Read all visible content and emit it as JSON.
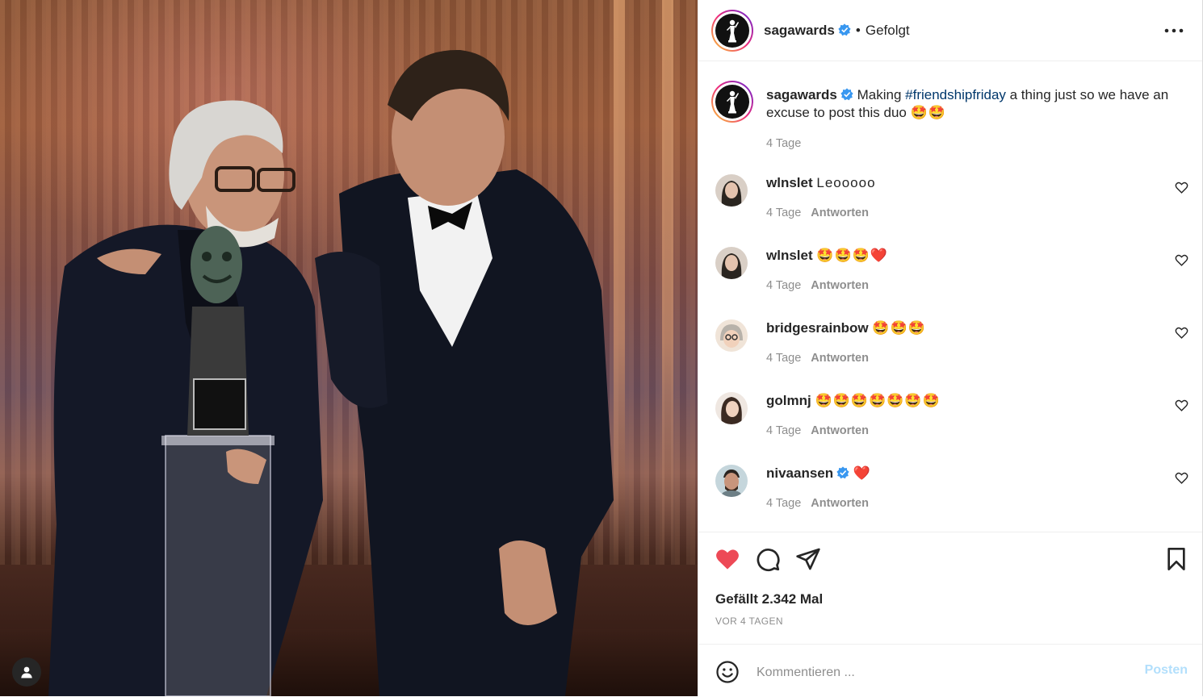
{
  "post": {
    "author": "sagawards",
    "follow_status": "Gefolgt",
    "separator": "•"
  },
  "caption": {
    "author": "sagawards",
    "text_before": "Making ",
    "hashtag": "#friendshipfriday",
    "text_after": " a thing just so we have an excuse to post this duo",
    "emojis": "🤩🤩",
    "time": "4 Tage"
  },
  "comments": [
    {
      "user": "wlnslet",
      "verified": false,
      "text": "Leooooo",
      "time": "4 Tage",
      "reply": "Antworten"
    },
    {
      "user": "wlnslet",
      "verified": false,
      "text": "🤩🤩🤩❤️",
      "time": "4 Tage",
      "reply": "Antworten"
    },
    {
      "user": "bridgesrainbow",
      "verified": false,
      "text": "🤩🤩🤩",
      "time": "4 Tage",
      "reply": "Antworten"
    },
    {
      "user": "golmnj",
      "verified": false,
      "text": "🤩🤩🤩🤩🤩🤩🤩",
      "time": "4 Tage",
      "reply": "Antworten"
    },
    {
      "user": "nivaansen",
      "verified": true,
      "text": "❤️",
      "time": "4 Tage",
      "reply": "Antworten"
    }
  ],
  "actions": {
    "likes": "Gefällt 2.342 Mal",
    "date": "VOR 4 TAGEN",
    "liked": true
  },
  "comment_box": {
    "placeholder": "Kommentieren ...",
    "post_label": "Posten"
  },
  "colors": {
    "like_red": "#ed4956",
    "verified_blue": "#3897f0",
    "hashtag": "#00376b",
    "muted": "#8e8e8e"
  }
}
